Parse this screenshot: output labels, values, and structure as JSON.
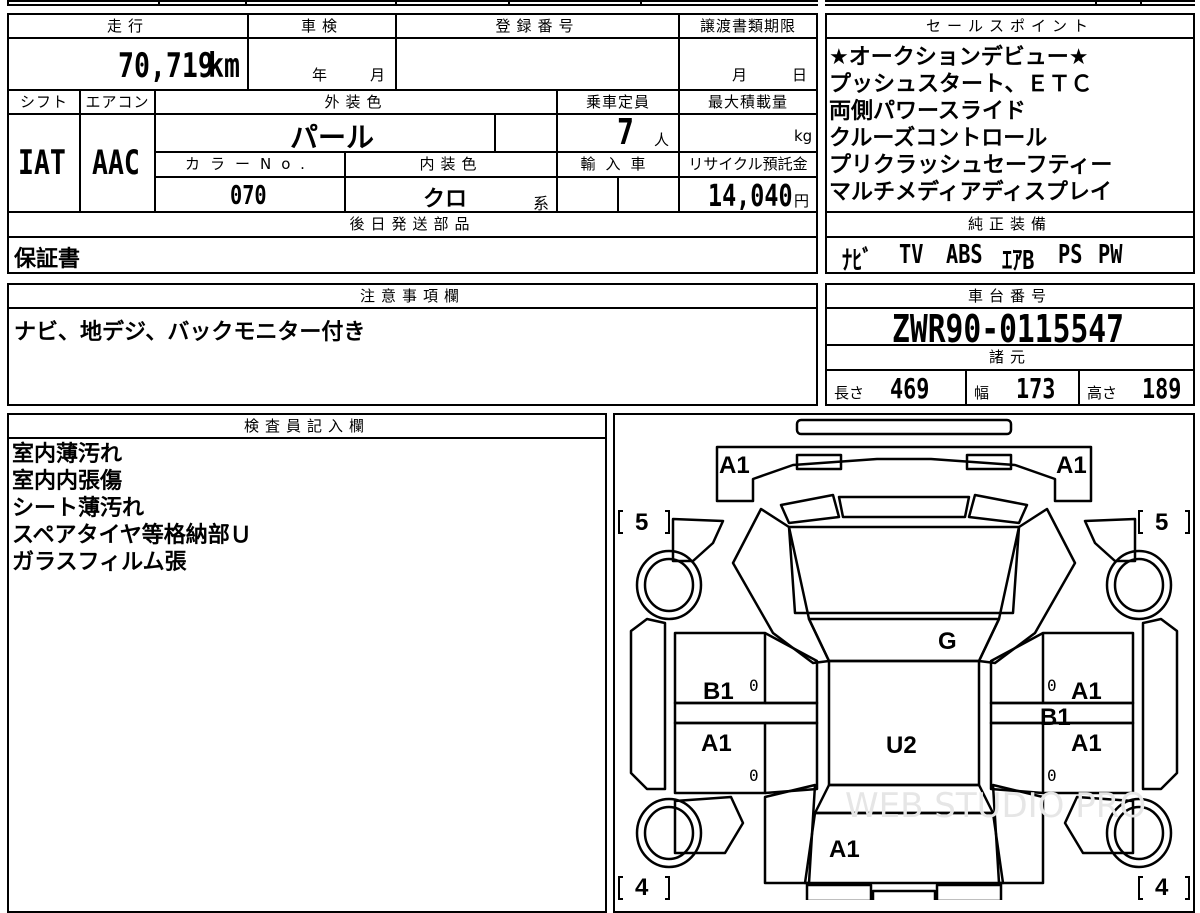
{
  "top_table": {
    "h_mileage": "走行",
    "h_inspection": "車検",
    "h_registration": "登録番号",
    "h_transfer_deadline": "譲渡書類期限",
    "mileage_value": "70,719",
    "mileage_unit": "km",
    "inspection_year": "年",
    "inspection_month": "月",
    "deadline_month": "月",
    "deadline_day": "日",
    "h_shift": "シフト",
    "h_aircon": "エアコン",
    "h_exterior_color": "外装色",
    "h_capacity": "乗車定員",
    "h_max_load": "最大積載量",
    "shift_value": "IAT",
    "aircon_value": "AAC",
    "exterior_color_value": "パール",
    "capacity_value": "7",
    "capacity_unit": "人",
    "load_unit": "kg",
    "h_color_no": "カラーNo.",
    "h_interior_color": "内装色",
    "h_import": "輸入車",
    "h_recycle": "リサイクル預託金",
    "color_no_value": "070",
    "interior_color_value": "クロ",
    "interior_color_suffix": "系",
    "recycle_value": "14,040",
    "recycle_unit": "円",
    "h_later_parts": "後日発送部品",
    "later_parts_value": "保証書"
  },
  "sales_points": {
    "header": "セールスポイント",
    "lines": [
      "★オークションデビュー★",
      "プッシュスタート、ＥＴＣ",
      "両側パワースライド",
      "クルーズコントロール",
      "プリクラッシュセーフティー",
      "マルチメディアディスプレイ"
    ]
  },
  "genuine_equipment": {
    "header": "純正装備",
    "items": [
      "ﾅﾋﾞ",
      "TV",
      "ABS",
      "ｴｱB",
      "PS",
      "PW"
    ]
  },
  "notes": {
    "header": "注意事項欄",
    "text": "ナビ、地デジ、バックモニター付き"
  },
  "chassis": {
    "header": "車台番号",
    "value": "ZWR90-0115547"
  },
  "specs": {
    "header": "諸元",
    "length_label": "長さ",
    "length_value": "469",
    "width_label": "幅",
    "width_value": "173",
    "height_label": "高さ",
    "height_value": "189"
  },
  "inspector": {
    "header": "検査員記入欄",
    "lines": [
      "室内薄汚れ",
      "室内内張傷",
      "シート薄汚れ",
      "スペアタイヤ等格納部Ｕ",
      "ガラスフィルム張"
    ]
  },
  "diagram": {
    "tire_front_left": "5",
    "tire_front_right": "5",
    "tire_rear_left": "4",
    "tire_rear_right": "4",
    "mark_front_left": "A1",
    "mark_front_right": "A1",
    "mark_windshield": "G",
    "mark_left_front_door": "B1",
    "mark_left_rear_door": "A1",
    "mark_right_front_door": "A1",
    "mark_right_b": "B1",
    "mark_right_rear_door": "A1",
    "mark_roof": "U2",
    "mark_rear": "A1",
    "zero_lf": "0",
    "zero_lr": "0",
    "zero_rf": "0",
    "zero_rr": "0",
    "watermark": "WEB STUDIO PRO"
  }
}
